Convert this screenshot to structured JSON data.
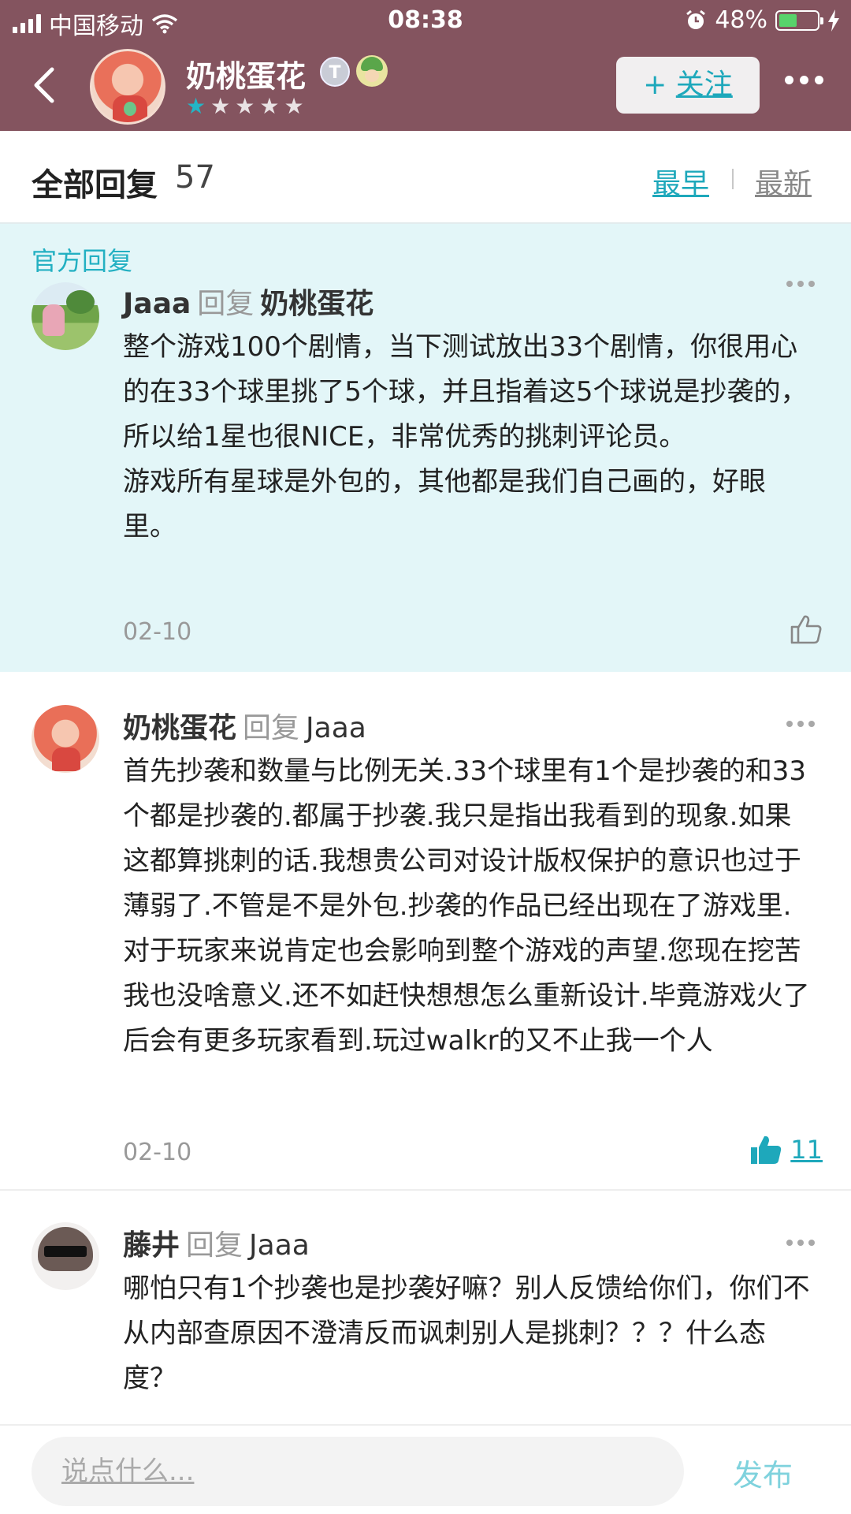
{
  "status": {
    "carrier": "中国移动",
    "time": "08:38",
    "battery": "48%",
    "battery_level": 0.48
  },
  "nav": {
    "title": "奶桃蛋花",
    "badge": "T",
    "rating": {
      "filled": 1,
      "total": 5,
      "accent_color": "#23b5c6"
    },
    "follow_label": "关注",
    "follow_plus": "+"
  },
  "sort": {
    "title": "全部回复",
    "count": "57",
    "earliest": "最早",
    "newest": "最新"
  },
  "comments": [
    {
      "section_label": "官方回复",
      "user": "Jaaa",
      "reply_word": "回复",
      "target": "奶桃蛋花",
      "body": "整个游戏100个剧情，当下测试放出33个剧情，你很用心的在33个球里挑了5个球，并且指着这5个球说是抄袭的，所以给1星也很NICE，非常优秀的挑刺评论员。\n游戏所有星球是外包的，其他都是我们自己画的，好眼里。",
      "date": "02-10",
      "likes": ""
    },
    {
      "user": "奶桃蛋花",
      "reply_word": "回复",
      "target": "Jaaa",
      "body": "首先抄袭和数量与比例无关.33个球里有1个是抄袭的和33个都是抄袭的.都属于抄袭.我只是指出我看到的现象.如果这都算挑刺的话.我想贵公司对设计版权保护的意识也过于薄弱了.不管是不是外包.抄袭的作品已经出现在了游戏里.对于玩家来说肯定也会影响到整个游戏的声望.您现在挖苦我也没啥意义.还不如赶快想想怎么重新设计.毕竟游戏火了后会有更多玩家看到.玩过walkr的又不止我一个人",
      "date": "02-10",
      "likes": "11"
    },
    {
      "user": "藤井",
      "reply_word": "回复",
      "target": "Jaaa",
      "body": "哪怕只有1个抄袭也是抄袭好嘛？别人反馈给你们，你们不从内部查原因不澄清反而讽刺别人是挑刺？？？什么态度？"
    }
  ],
  "composer": {
    "placeholder": "说点什么...",
    "publish": "发布"
  },
  "colors": {
    "header_bg": "#84545f",
    "accent": "#1ea8bb",
    "official_bg": "#e3f6f8"
  }
}
